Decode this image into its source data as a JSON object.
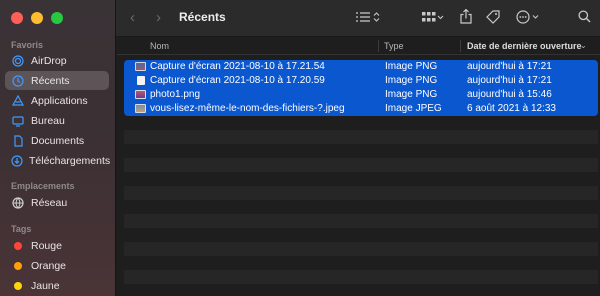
{
  "window": {
    "title": "Récents"
  },
  "sidebar": {
    "favorites_title": "Favoris",
    "favorites": [
      {
        "label": "AirDrop",
        "icon": "airdrop-icon"
      },
      {
        "label": "Récents",
        "icon": "clock-icon",
        "active": true
      },
      {
        "label": "Applications",
        "icon": "applications-icon"
      },
      {
        "label": "Bureau",
        "icon": "desktop-icon"
      },
      {
        "label": "Documents",
        "icon": "document-icon"
      },
      {
        "label": "Téléchargements",
        "icon": "download-icon"
      }
    ],
    "locations_title": "Emplacements",
    "locations": [
      {
        "label": "Réseau",
        "icon": "network-icon"
      }
    ],
    "tags_title": "Tags",
    "tags": [
      {
        "label": "Rouge",
        "color": "#ff453a"
      },
      {
        "label": "Orange",
        "color": "#ff9f0a"
      },
      {
        "label": "Jaune",
        "color": "#ffd60a"
      }
    ]
  },
  "columns": {
    "name": "Nom",
    "type": "Type",
    "date": "Date de dernière ouverture"
  },
  "files": [
    {
      "name": "Capture d'écran 2021-08-10 à 17.21.54",
      "type": "Image PNG",
      "date": "aujourd'hui à 17:21",
      "icon": "screenshot-file-icon"
    },
    {
      "name": "Capture d'écran 2021-08-10 à 17.20.59",
      "type": "Image PNG",
      "date": "aujourd'hui à 17:21",
      "icon": "blank-file-icon"
    },
    {
      "name": "photo1.png",
      "type": "Image PNG",
      "date": "aujourd'hui à 15:46",
      "icon": "image-file-icon"
    },
    {
      "name": "vous-lisez-même-le-nom-des-fichiers-?.jpeg",
      "type": "Image JPEG",
      "date": "6 août 2021 à 12:33",
      "icon": "jpeg-file-icon"
    }
  ],
  "colors": {
    "selection": "#0a57d0",
    "accent": "#3f9bff"
  }
}
